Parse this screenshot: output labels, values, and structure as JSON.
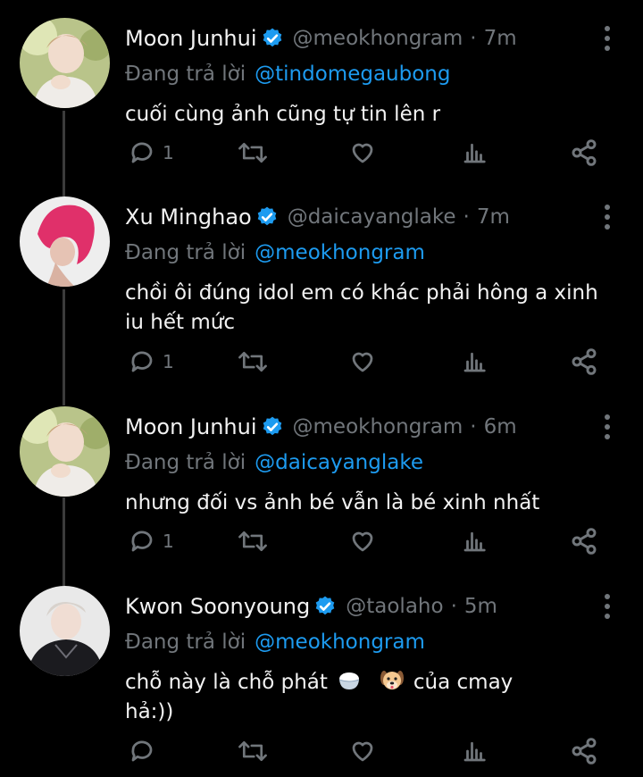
{
  "colors": {
    "background": "#000000",
    "text": "#f2f2f2",
    "muted": "#71767b",
    "accent": "#1d9bf0"
  },
  "replying_prefix": "Đang trả lời",
  "tweets": [
    {
      "name": "Moon Junhui",
      "handle": "@meokhongram",
      "dot": "·",
      "time": "7m",
      "reply_to": "@tindomegaubong",
      "text": "cuối cùng ảnh cũng tự tin lên r",
      "reply_count": "1",
      "avatar": "photo-light-hair"
    },
    {
      "name": "Xu Minghao",
      "handle": "@daicayanglake",
      "dot": "·",
      "time": "7m",
      "reply_to": "@meokhongram",
      "text": "chồi ôi đúng idol em có khác phải hông a xinh iu hết mức",
      "reply_count": "1",
      "avatar": "photo-pink-hair"
    },
    {
      "name": "Moon Junhui",
      "handle": "@meokhongram",
      "dot": "·",
      "time": "6m",
      "reply_to": "@daicayanglake",
      "text": "nhưng đối vs ảnh bé vẫn là bé xinh nhất",
      "reply_count": "1",
      "avatar": "photo-light-hair"
    },
    {
      "name": "Kwon Soonyoung",
      "handle": "@taolaho",
      "dot": "·",
      "time": "5m",
      "reply_to": "@meokhongram",
      "text_part1": "chỗ này là chỗ phát",
      "text_part2": "của cmay",
      "text_part3": "hả:))",
      "emojis": [
        "rice-bowl",
        "dog-face"
      ],
      "reply_count": "",
      "avatar": "photo-dark-outfit"
    }
  ]
}
